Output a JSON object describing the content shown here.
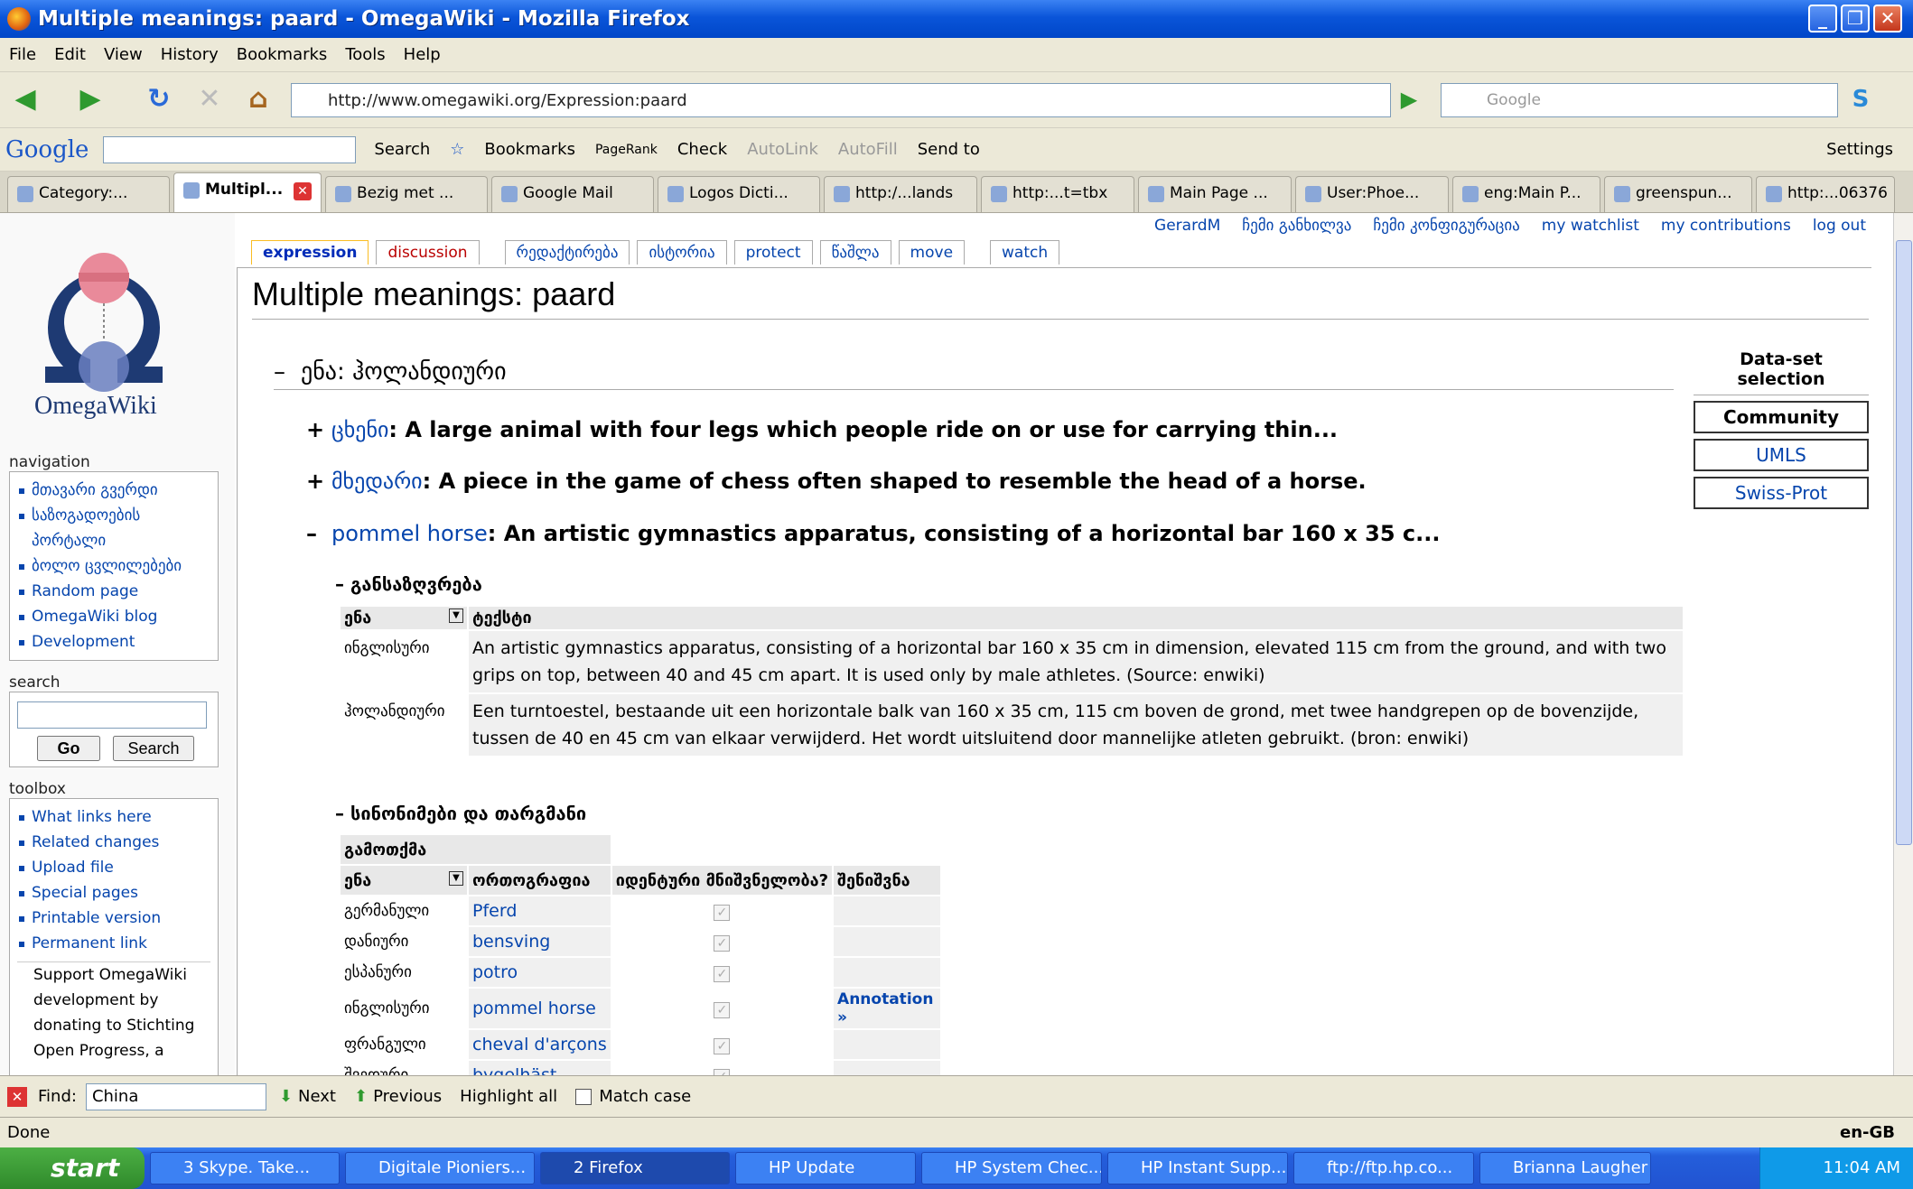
{
  "window": {
    "title": "Multiple meanings: paard - OmegaWiki - Mozilla Firefox"
  },
  "menu": [
    "File",
    "Edit",
    "View",
    "History",
    "Bookmarks",
    "Tools",
    "Help"
  ],
  "nav": {
    "url": "http://www.omegawiki.org/Expression:paard",
    "search_placeholder": "Google"
  },
  "google_toolbar": {
    "logo": "Google",
    "search": "Search",
    "bookmarks": "Bookmarks",
    "pagerank": "PageRank",
    "check": "Check",
    "autolink": "AutoLink",
    "autofill": "AutoFill",
    "sendto": "Send to",
    "settings": "Settings"
  },
  "tabs": [
    "Category:...",
    "Multipl...",
    "Bezig met ...",
    "Google Mail",
    "Logos Dicti...",
    "http:/...lands",
    "http:...t=tbx",
    "Main Page ...",
    "User:Phoe...",
    "eng:Main P...",
    "greenspun...",
    "http:...06376"
  ],
  "userlinks": [
    "GerardM",
    "ჩემი განხილვა",
    "ჩემი კონფიგურაცია",
    "my watchlist",
    "my contributions",
    "log out"
  ],
  "content_tabs": [
    "expression",
    "discussion",
    "რედაქტირება",
    "ისტორია",
    "protect",
    "წაშლა",
    "move",
    "watch"
  ],
  "sidebar": {
    "logo": "OmegaWiki",
    "navigation_title": "navigation",
    "navigation": [
      "მთავარი გვერდი",
      "საზოგადოების",
      "პორტალი",
      "ბოლო ცვლილებები",
      "Random page",
      "OmegaWiki blog",
      "Development"
    ],
    "search_title": "search",
    "go": "Go",
    "search": "Search",
    "toolbox_title": "toolbox",
    "toolbox": [
      "What links here",
      "Related changes",
      "Upload file",
      "Special pages",
      "Printable version",
      "Permanent link"
    ],
    "support": [
      "Support OmegaWiki",
      "development by",
      "donating to Stichting",
      "Open Progress, a"
    ]
  },
  "page": {
    "title": "Multiple meanings: paard",
    "language_heading": "ენა: ჰოლანდიური",
    "definitions": [
      {
        "sign": "+",
        "word": "ცხენი",
        "text": ": A large animal with four legs which people ride on or use for carrying thin..."
      },
      {
        "sign": "+",
        "word": "მხედარი",
        "text": ": A piece in the game of chess often shaped to resemble the head of a horse."
      },
      {
        "sign": "–",
        "word": "pommel horse",
        "text": ": An artistic gymnastics apparatus, consisting of a horizontal bar 160 x 35 c..."
      }
    ],
    "definition_heading": "– განსაზღვრება",
    "def_table": {
      "col_lang": "ენა",
      "col_text": "ტექსტი",
      "rows": [
        {
          "lang": "ინგლისური",
          "text": "An artistic gymnastics apparatus, consisting of a horizontal bar 160 x 35 cm in dimension, elevated 115 cm from the ground, and with two grips on top, between 40 and 45 cm apart. It is used only by male athletes. (Source: enwiki)"
        },
        {
          "lang": "ჰოლანდიური",
          "text": "Een turntoestel, bestaande uit een horizontale balk van 160 x 35 cm, 115 cm boven de grond, met twee handgrepen op de bovenzijde, tussen de 40 en 45 cm van elkaar verwijderd. Het wordt uitsluitend door mannelijke atleten gebruikt. (bron: enwiki)"
        }
      ]
    },
    "syn_heading": "– სინონიმები და თარგმანი",
    "syn_table": {
      "group": "გამოთქმა",
      "col_lang": "ენა",
      "col_spell": "ორთოგრაფია",
      "col_ident": "იდენტური მნიშვნელობა?",
      "col_note": "შენიშვნა",
      "rows": [
        {
          "lang": "გერმანული",
          "spell": "Pferd",
          "note": ""
        },
        {
          "lang": "დანიური",
          "spell": "bensving",
          "note": ""
        },
        {
          "lang": "ესპანური",
          "spell": "potro",
          "note": ""
        },
        {
          "lang": "ინგლისური",
          "spell": "pommel horse",
          "note": "Annotation »"
        },
        {
          "lang": "ფრანგული",
          "spell": "cheval d'arçons",
          "note": ""
        },
        {
          "lang": "შვედური",
          "spell": "bygelhäst",
          "note": ""
        }
      ]
    },
    "dataset": {
      "title": "Data-set selection",
      "options": [
        "Community",
        "UMLS",
        "Swiss-Prot"
      ]
    }
  },
  "findbar": {
    "label": "Find:",
    "value": "China",
    "next": "Next",
    "previous": "Previous",
    "highlight": "Highlight all",
    "match": "Match case"
  },
  "status": {
    "text": "Done",
    "locale": "en-GB"
  },
  "taskbar": {
    "start": "start",
    "items": [
      "3 Skype. Take...",
      "Digitale Pioniers...",
      "2 Firefox",
      "HP Update",
      "HP System Chec...",
      "HP Instant Supp...",
      "ftp://ftp.hp.co...",
      "Brianna Laugher"
    ],
    "clock": "11:04 AM"
  }
}
